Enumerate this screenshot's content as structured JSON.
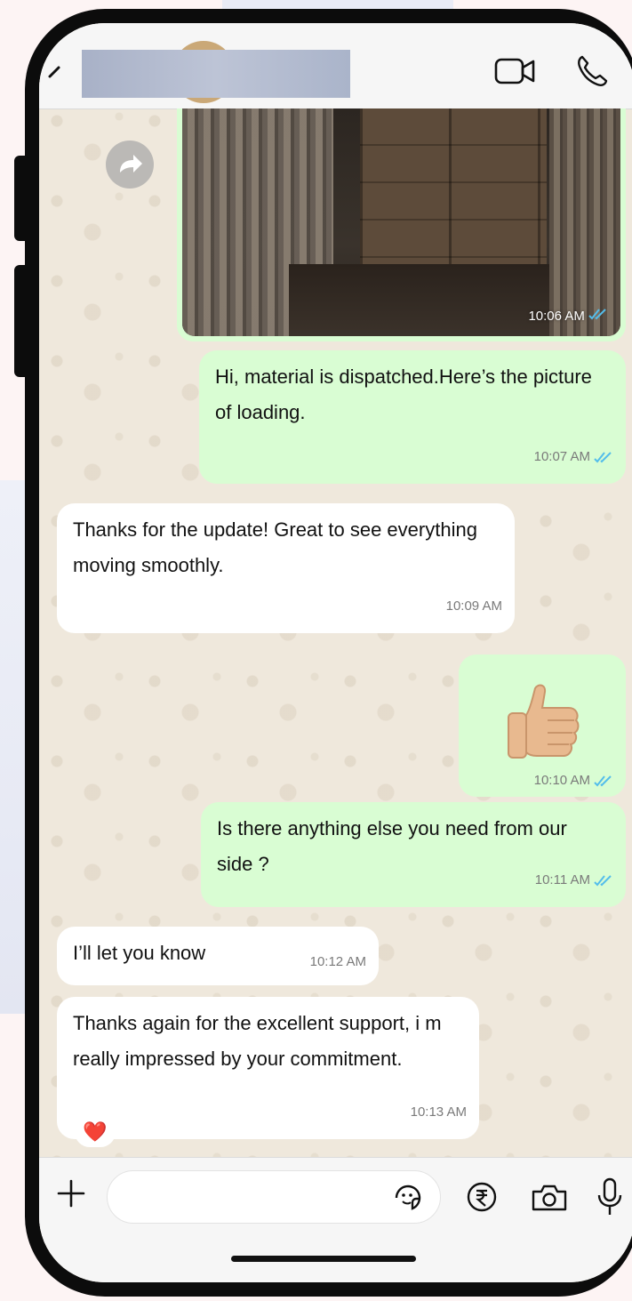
{
  "header": {
    "contact_name_redacted": "",
    "icons": [
      "back-icon",
      "video-call-icon",
      "voice-call-icon"
    ]
  },
  "messages": [
    {
      "type": "image",
      "direction": "out",
      "time": "10:06 AM",
      "status": "read"
    },
    {
      "type": "text",
      "direction": "out",
      "text": "Hi, material is dispatched.Here’s the picture of loading.",
      "time": "10:07 AM",
      "status": "read"
    },
    {
      "type": "text",
      "direction": "in",
      "text": "Thanks for the update! Great to see everything moving smoothly.",
      "time": "10:09 AM"
    },
    {
      "type": "emoji",
      "direction": "out",
      "emoji": "👍🏼",
      "time": "10:10 AM",
      "status": "read"
    },
    {
      "type": "text",
      "direction": "out",
      "text": "Is there anything else you need from our side ?",
      "time": "10:11 AM",
      "status": "read"
    },
    {
      "type": "text",
      "direction": "in",
      "text": "I’ll let you know",
      "time": "10:12 AM"
    },
    {
      "type": "text",
      "direction": "in",
      "text": "Thanks again for the excellent support, i m really impressed by your commitment.",
      "time": "10:13 AM",
      "reaction": "❤️"
    }
  ],
  "input": {
    "placeholder": "",
    "value": ""
  },
  "colors": {
    "outgoing_bubble": "#d9fdd3",
    "incoming_bubble": "#ffffff",
    "read_ticks": "#53bdeb",
    "header_bg": "#f6f6f6"
  }
}
